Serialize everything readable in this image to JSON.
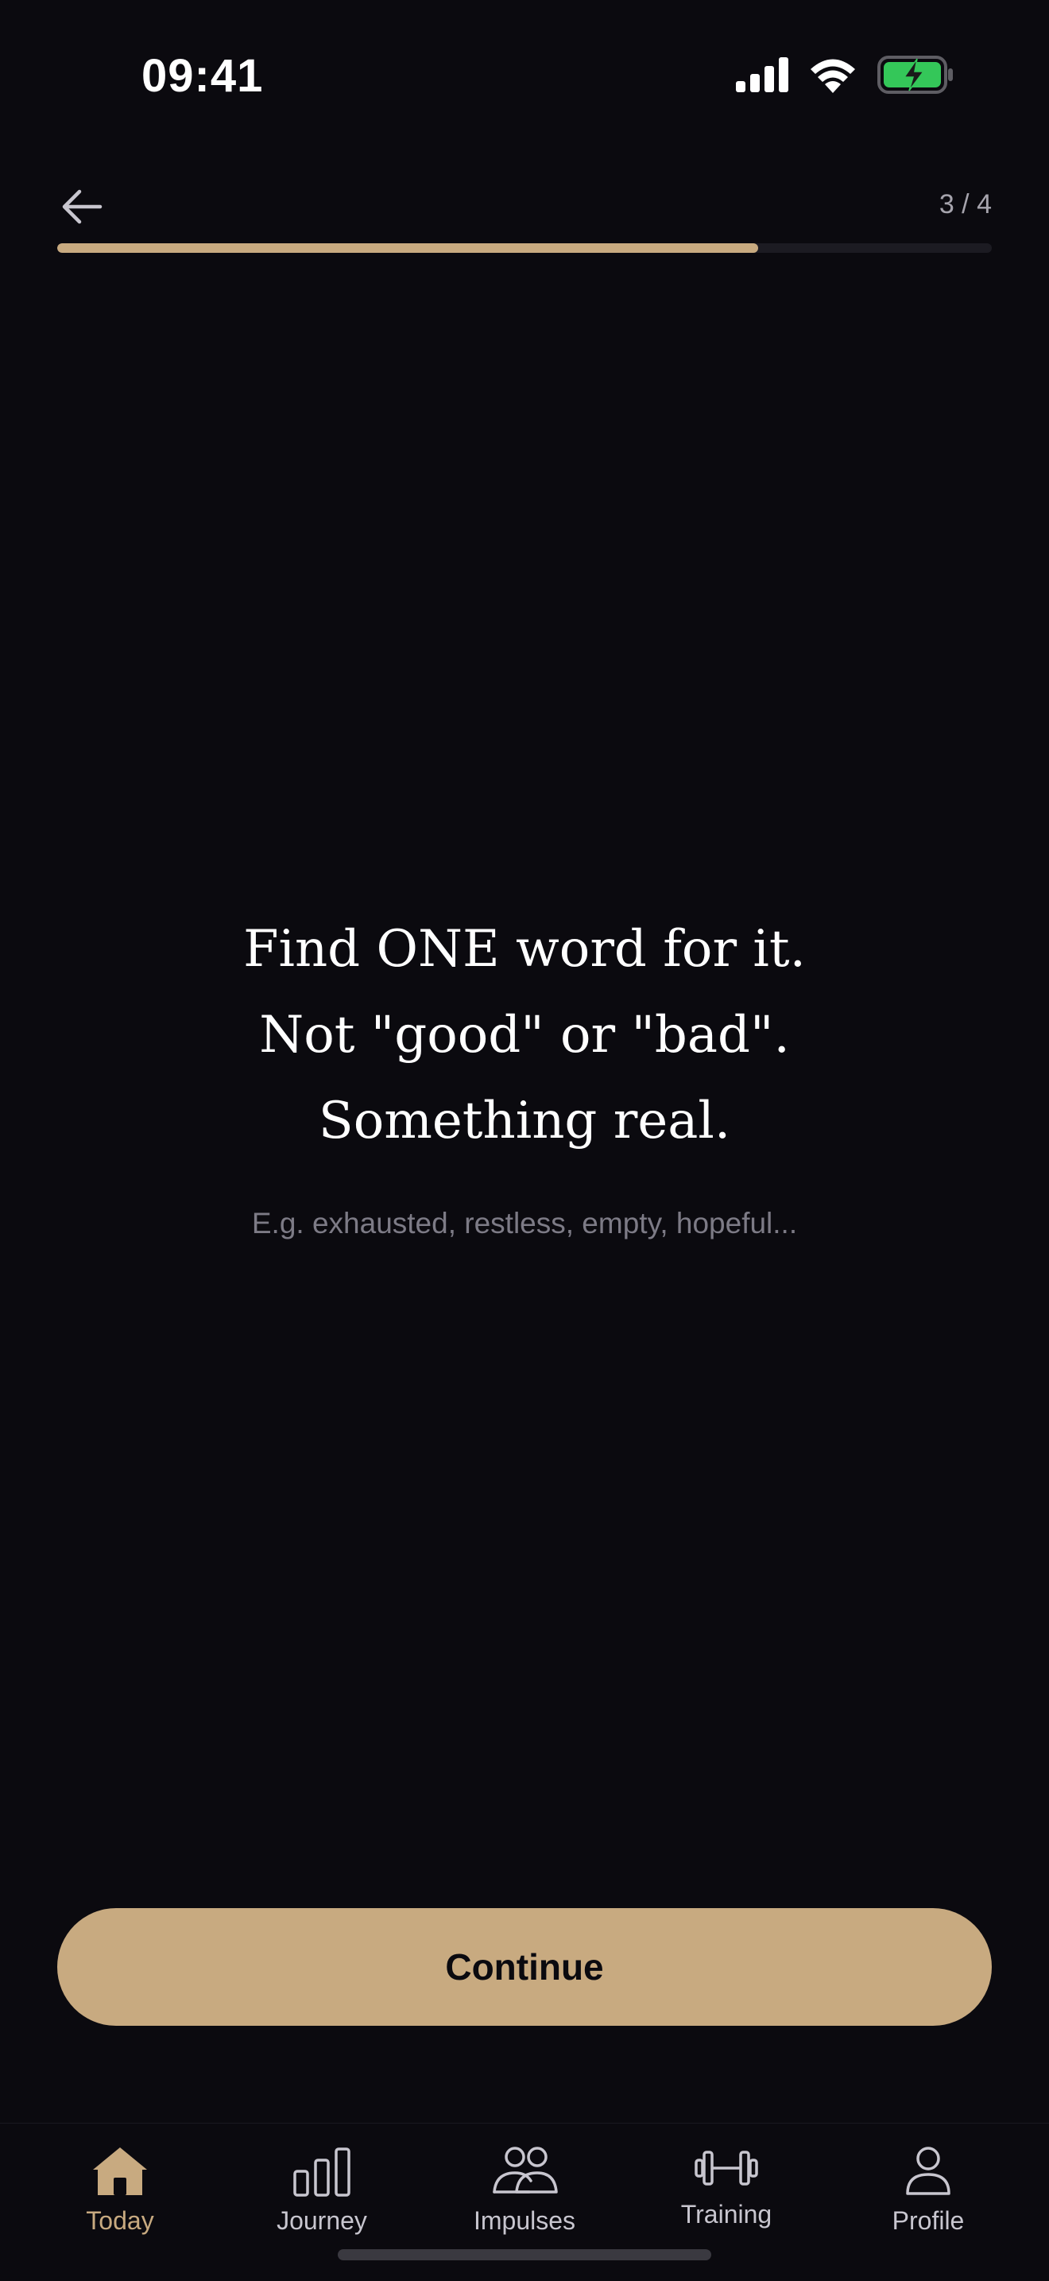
{
  "status_bar": {
    "time": "09:41",
    "icons": [
      "cellular-signal-icon",
      "wifi-icon",
      "battery-charging-icon"
    ]
  },
  "header": {
    "step_counter": "3 / 4",
    "progress": 0.75
  },
  "prompt": {
    "lines": [
      "Find ONE word for it.",
      "Not \"good\" or \"bad\".",
      "Something real."
    ],
    "hint": "E.g. exhausted, restless, empty, hopeful..."
  },
  "actions": {
    "continue_label": "Continue"
  },
  "tab_bar": {
    "tabs": [
      {
        "label": "Today",
        "icon": "home-icon",
        "active": true
      },
      {
        "label": "Journey",
        "icon": "bar-chart-icon",
        "active": false
      },
      {
        "label": "Impulses",
        "icon": "people-icon",
        "active": false
      },
      {
        "label": "Training",
        "icon": "dumbbell-icon",
        "active": false
      },
      {
        "label": "Profile",
        "icon": "person-icon",
        "active": false
      }
    ]
  },
  "colors": {
    "background": "#0b0a0f",
    "accent": "#c8aa80",
    "muted_text": "#7d7b86",
    "battery_green": "#34c759"
  }
}
